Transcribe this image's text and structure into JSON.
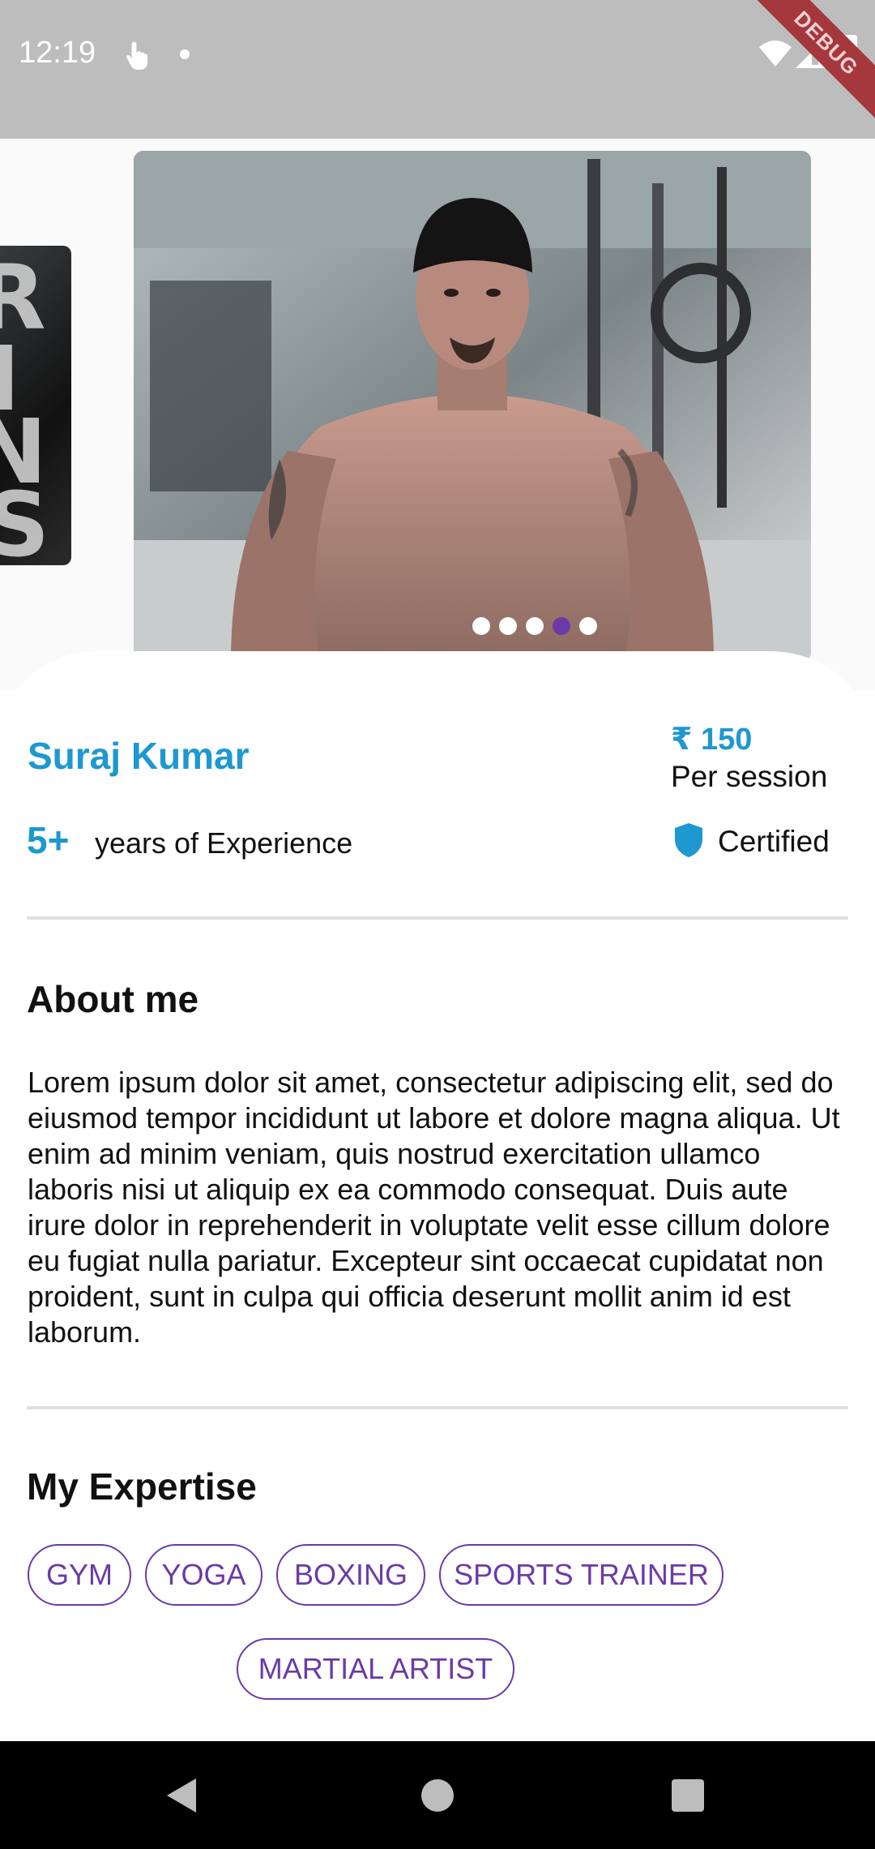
{
  "status_bar": {
    "time": "12:19",
    "debug_label": "DEBUG"
  },
  "carousel": {
    "slide_count": 5,
    "active_index": 3
  },
  "profile": {
    "name": "Suraj Kumar",
    "price": "₹ 150",
    "price_unit": "Per session",
    "experience_value": "5+",
    "experience_label": "years of Experience",
    "certified_label": "Certified"
  },
  "about": {
    "title": "About me",
    "text": "Lorem ipsum dolor sit amet, consectetur adipiscing elit, sed do eiusmod tempor incididunt ut labore et dolore magna aliqua. Ut enim ad minim veniam, quis nostrud exercitation ullamco laboris nisi ut aliquip ex ea commodo consequat. Duis aute irure dolor in reprehenderit in voluptate velit esse cillum dolore eu fugiat nulla pariatur. Excepteur sint occaecat cupidatat non proident, sunt in culpa qui officia deserunt mollit anim id est laborum."
  },
  "expertise": {
    "title": "My Expertise",
    "chips": [
      "GYM",
      "YOGA",
      "BOXING",
      "SPORTS TRAINER",
      "MARTIAL ARTIST"
    ]
  },
  "colors": {
    "accent_blue": "#1e98d0",
    "chip_purple": "#6b3aa8",
    "status_gray": "#bdbdbd"
  },
  "icons": [
    "touch-icon",
    "wifi-icon",
    "signal-icon",
    "battery-icon",
    "shield-icon",
    "back-icon",
    "home-icon",
    "recent-apps-icon"
  ]
}
